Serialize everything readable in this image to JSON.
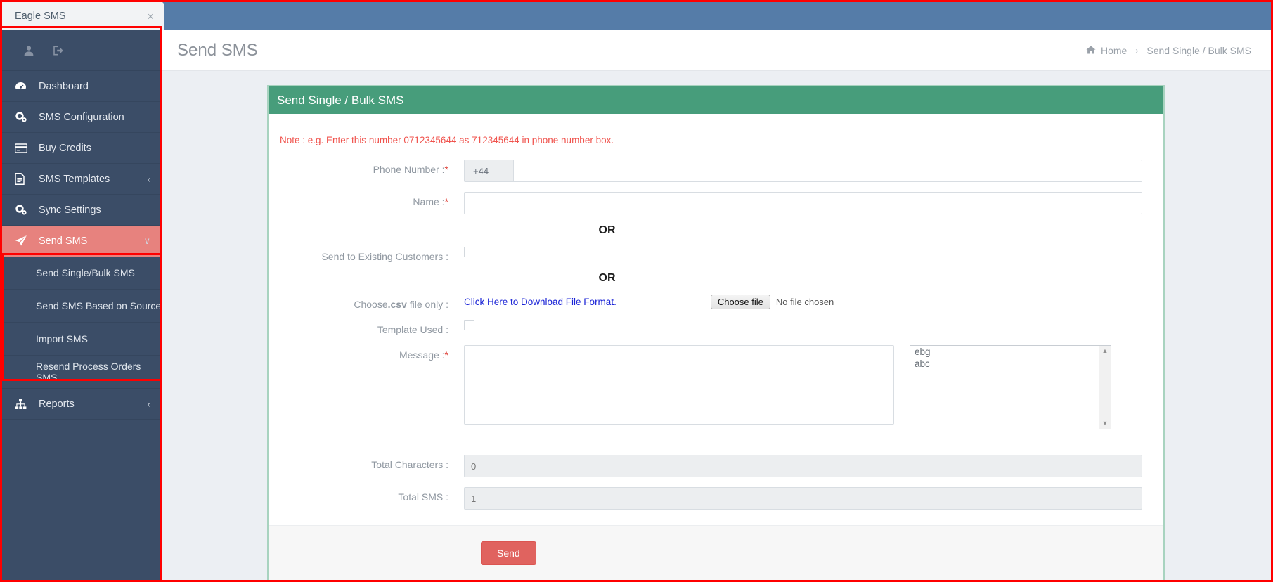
{
  "browser": {
    "tab_title": "Eagle SMS",
    "close_label": "×"
  },
  "sidebar": {
    "user_icon": "user-icon",
    "logout_icon": "logout-icon",
    "items": [
      {
        "label": "Dashboard",
        "icon": "dashboard-icon",
        "active": false,
        "caret": ""
      },
      {
        "label": "SMS Configuration",
        "icon": "gears-icon",
        "active": false,
        "caret": ""
      },
      {
        "label": "Buy Credits",
        "icon": "credit-card-icon",
        "active": false,
        "caret": ""
      },
      {
        "label": "SMS Templates",
        "icon": "file-text-icon",
        "active": false,
        "caret": "‹"
      },
      {
        "label": "Sync Settings",
        "icon": "gears-icon",
        "active": false,
        "caret": ""
      },
      {
        "label": "Send SMS",
        "icon": "paper-plane-icon",
        "active": true,
        "caret": "∨"
      }
    ],
    "submenu": [
      {
        "label": "Send Single/Bulk SMS"
      },
      {
        "label": "Send SMS Based on Source"
      },
      {
        "label": "Import SMS"
      },
      {
        "label": "Resend Process Orders SMS"
      }
    ],
    "reports": {
      "label": "Reports",
      "icon": "sitemap-icon",
      "caret": "‹"
    }
  },
  "header": {
    "title": "Send SMS",
    "breadcrumb": {
      "home_icon": "home-icon",
      "home": "Home",
      "separator": "›",
      "current": "Send Single / Bulk SMS"
    }
  },
  "panel": {
    "title": "Send Single / Bulk SMS",
    "note": "Note : e.g. Enter this number 0712345644 as 712345644 in phone number box.",
    "fields": {
      "phone": {
        "label": "Phone Number :",
        "required": "*",
        "country_code": "+44",
        "value": "",
        "placeholder": ""
      },
      "name": {
        "label": "Name :",
        "required": "*",
        "value": "",
        "placeholder": ""
      },
      "or_1": "OR",
      "existing_customers": {
        "label": "Send to Existing Customers :",
        "checked": false
      },
      "or_2": "OR",
      "csv": {
        "label_prefix": "Choose",
        "label_strong": ".csv",
        "label_suffix": " file only :",
        "download_link": "Click Here to Download File Format.",
        "choose_button": "Choose file",
        "no_file_text": "No file chosen"
      },
      "template_used": {
        "label": "Template Used :",
        "checked": false
      },
      "message": {
        "label": "Message :",
        "required": "*",
        "value": "",
        "placeholder": ""
      },
      "template_list": {
        "options": [
          "ebg",
          "abc"
        ],
        "scroll_up": "▲",
        "scroll_down": "▼"
      },
      "total_characters": {
        "label": "Total Characters :",
        "value": "0"
      },
      "total_sms": {
        "label": "Total SMS :",
        "value": "1"
      }
    },
    "send_button": "Send"
  },
  "colors": {
    "sidebar_bg": "#3b4d67",
    "active_item": "#e7827e",
    "panel_header": "#479d7b",
    "panel_border": "#a8d3bf",
    "note_red": "#f0534d",
    "link_blue": "#1a23d6",
    "send_button": "#e0635f",
    "annotation_red": "#ff0000",
    "tabstrip_blue": "#557ca8"
  }
}
